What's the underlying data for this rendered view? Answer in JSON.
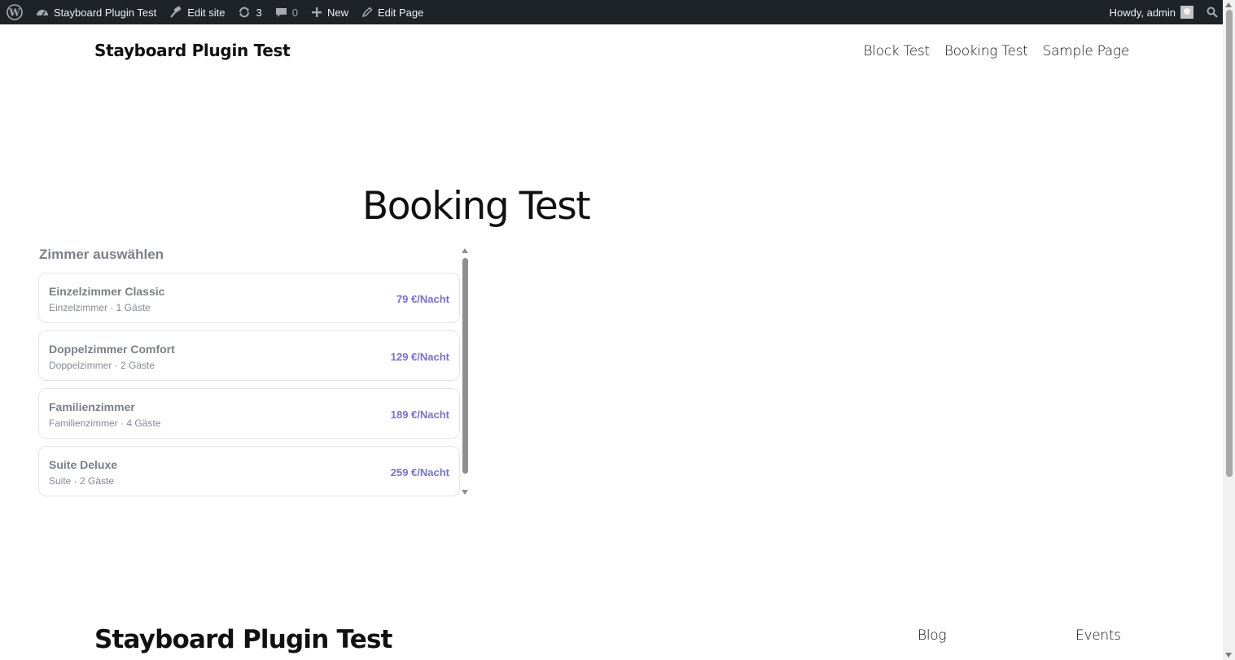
{
  "adminbar": {
    "site_name": "Stayboard Plugin Test",
    "edit_site": "Edit site",
    "updates_count": "3",
    "comments_count": "0",
    "new_label": "New",
    "edit_page": "Edit Page",
    "howdy": "Howdy, admin"
  },
  "header": {
    "site_title": "Stayboard Plugin Test",
    "nav": [
      "Block Test",
      "Booking Test",
      "Sample Page"
    ]
  },
  "page": {
    "title": "Booking Test"
  },
  "rooms": {
    "heading": "Zimmer auswählen",
    "items": [
      {
        "name": "Einzelzimmer Classic",
        "sub": "Einzelzimmer · 1 Gäste",
        "price": "79 €/Nacht"
      },
      {
        "name": "Doppelzimmer Comfort",
        "sub": "Doppelzimmer · 2 Gäste",
        "price": "129 €/Nacht"
      },
      {
        "name": "Familienzimmer",
        "sub": "Familienzimmer · 4 Gäste",
        "price": "189 €/Nacht"
      },
      {
        "name": "Suite Deluxe",
        "sub": "Suite · 2 Gäste",
        "price": "259 €/Nacht"
      }
    ]
  },
  "footer": {
    "site_title": "Stayboard Plugin Test",
    "links": [
      "Blog",
      "Events"
    ]
  },
  "colors": {
    "adminbar_bg": "#1d2327",
    "price_accent": "#7b6fd6"
  }
}
